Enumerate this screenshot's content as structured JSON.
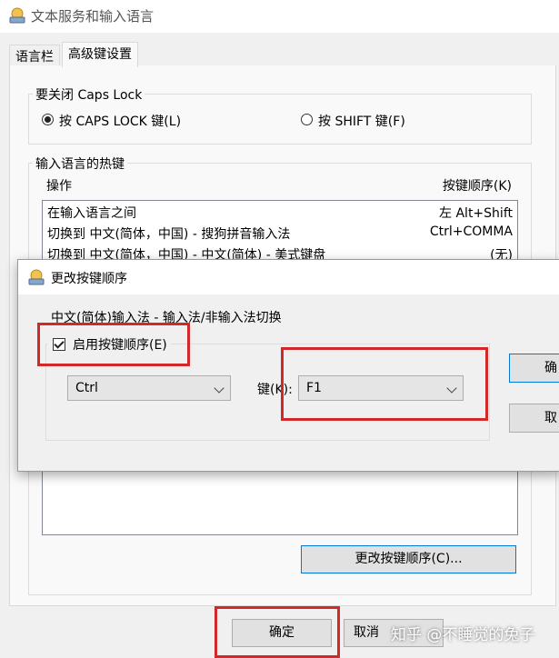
{
  "window": {
    "title": "文本服务和输入语言"
  },
  "tabs": [
    {
      "label": "语言栏",
      "active": false
    },
    {
      "label": "高级键设置",
      "active": true
    }
  ],
  "caps_lock": {
    "group_title": "要关闭 Caps Lock",
    "option_caps": "按 CAPS LOCK 键(L)",
    "option_shift": "按 SHIFT 键(F)",
    "selected": "caps"
  },
  "hotkeys": {
    "group_title": "输入语言的热键",
    "col_action": "操作",
    "col_sequence": "按键顺序(K)",
    "rows": [
      {
        "action": "在输入语言之间",
        "keys": "左 Alt+Shift"
      },
      {
        "action": "切换到 中文(简体，中国) - 搜狗拼音输入法",
        "keys": "Ctrl+COMMA"
      },
      {
        "action": "切换到 中文(简体，中国) - 中文(简体) - 美式键盘",
        "keys": "(无)"
      }
    ],
    "change_button": "更改按键顺序(C)..."
  },
  "footer": {
    "ok": "确定",
    "cancel": "取消"
  },
  "dialog": {
    "title": "更改按键顺序",
    "subtitle": "中文(简体)输入法 - 输入法/非输入法切换",
    "enable_label": "启用按键顺序(E)",
    "enabled": true,
    "modifier_value": "Ctrl",
    "key_label": "键(K):",
    "key_value": "F1",
    "ok": "确",
    "cancel": "取"
  },
  "watermark": "知乎 @不睡觉的兔子",
  "colors": {
    "highlight": "#d32828",
    "accent": "#0078d7"
  }
}
